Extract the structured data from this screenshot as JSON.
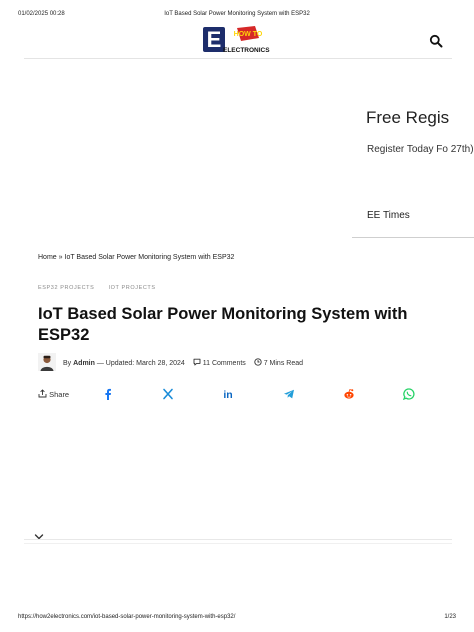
{
  "print_header": {
    "datetime": "01/02/2025 00:28",
    "doc_title": "IoT Based Solar Power Monitoring System with ESP32"
  },
  "print_footer": {
    "url": "https://how2electronics.com/iot-based-solar-power-monitoring-system-with-esp32/",
    "page": "1/23"
  },
  "site": {
    "logo_text": "ELECTRONICS",
    "logo_badge": "HOW TO",
    "logo_letter": "E"
  },
  "ad": {
    "title": "Free Regis",
    "subtitle": "Register Today Fo 27th).",
    "brand": "EE Times"
  },
  "breadcrumb": {
    "home": "Home",
    "separator": "»",
    "current": "IoT Based Solar Power Monitoring System with ESP32"
  },
  "tags": [
    "ESP32 PROJECTS",
    "IOT PROJECTS"
  ],
  "article": {
    "title": "IoT Based Solar Power Monitoring System with ESP32",
    "by": "By",
    "author": "Admin",
    "updated_label": "— Updated:",
    "date": "March 28, 2024",
    "comments": "11 Comments",
    "read_time": "7 Mins Read"
  },
  "share": {
    "label": "Share",
    "networks": [
      "facebook-icon",
      "x-icon",
      "linkedin-icon",
      "telegram-icon",
      "reddit-icon",
      "whatsapp-icon"
    ],
    "colors": {
      "facebook": "#1877f2",
      "x": "#1a8cd8",
      "linkedin": "#0a66c2",
      "telegram": "#229ed9",
      "reddit": "#ff4500",
      "whatsapp": "#25d366"
    }
  }
}
